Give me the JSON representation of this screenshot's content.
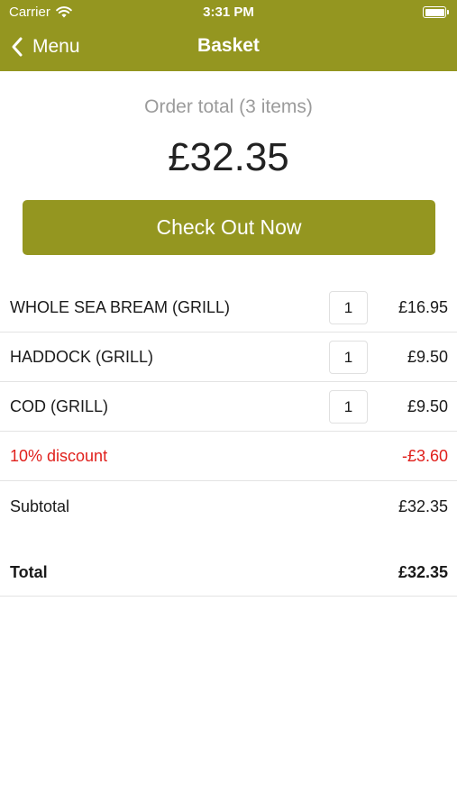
{
  "status_bar": {
    "carrier": "Carrier",
    "time": "3:31 PM"
  },
  "nav": {
    "back_label": "Menu",
    "title": "Basket"
  },
  "summary": {
    "label": "Order total (3 items)",
    "amount": "£32.35"
  },
  "checkout": {
    "label": "Check Out Now"
  },
  "items": [
    {
      "name": "WHOLE SEA BREAM (GRILL)",
      "qty": "1",
      "price": "£16.95"
    },
    {
      "name": "HADDOCK (GRILL)",
      "qty": "1",
      "price": "£9.50"
    },
    {
      "name": "COD (GRILL)",
      "qty": "1",
      "price": "£9.50"
    }
  ],
  "discount": {
    "label": "10% discount",
    "amount": "-£3.60"
  },
  "subtotal": {
    "label": "Subtotal",
    "amount": "£32.35"
  },
  "total": {
    "label": "Total",
    "amount": "£32.35"
  },
  "colors": {
    "brand": "#949620",
    "discount": "#e0201c"
  },
  "icons": [
    "wifi-icon",
    "battery-icon",
    "chevron-left-icon"
  ]
}
